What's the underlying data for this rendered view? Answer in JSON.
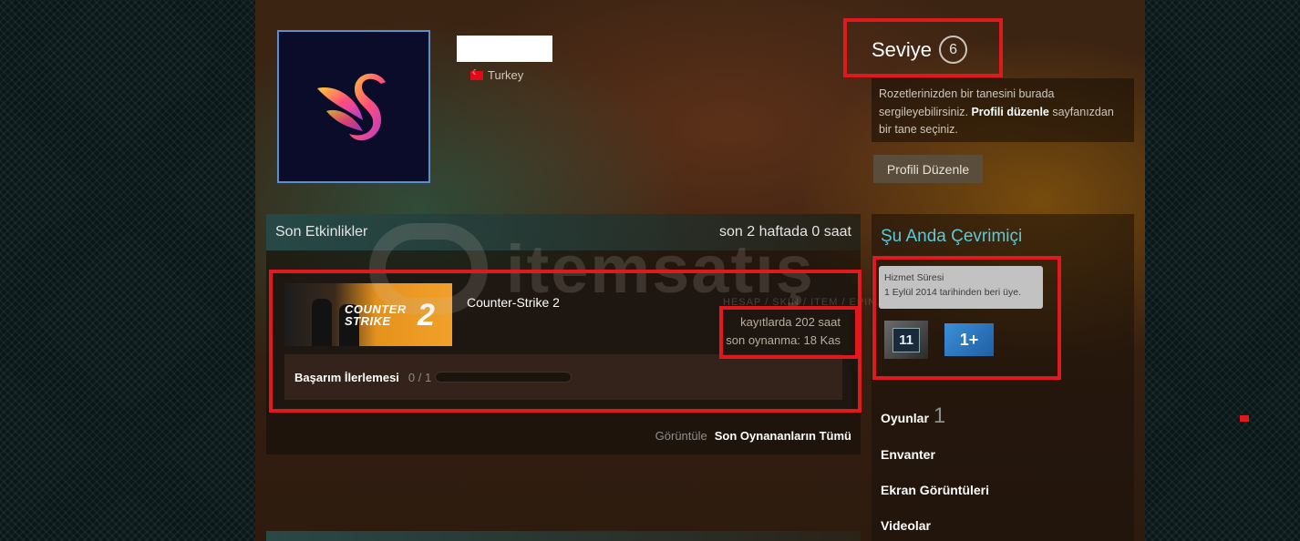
{
  "profile": {
    "country": "Turkey",
    "level_label": "Seviye",
    "level_value": "6",
    "badge_note_1": "Rozetlerinizden bir tanesini burada sergileyebilirsiniz.",
    "badge_note_link": "Profili düzenle",
    "badge_note_2": "sayfanızdan bir tane seçiniz.",
    "edit_button": "Profili Düzenle"
  },
  "activity": {
    "title": "Son Etkinlikler",
    "summary": "son 2 haftada 0 saat",
    "game": {
      "name": "Counter-Strike 2",
      "hours_total": "kayıtlarda 202 saat",
      "last_played": "son oynanma: 18 Kas",
      "logo_line1": "COUNTER",
      "logo_line2": "STRIKE",
      "logo_num": "2"
    },
    "achievement_label": "Başarım İlerlemesi",
    "achievement_count": "0 / 1",
    "achievement_progress": 0,
    "view_label": "Görüntüle",
    "view_link": "Son Oynananların Tümü"
  },
  "sidebar": {
    "online_title": "Şu Anda Çevrimiçi",
    "tooltip_title": "Hizmet Süresi",
    "tooltip_text": "1 Eylül 2014 tarihinden beri üye.",
    "years_badge": "11",
    "plus_badge": "1+",
    "nav": [
      {
        "label": "Oyunlar",
        "count": "1"
      },
      {
        "label": "Envanter"
      },
      {
        "label": "Ekran Görüntüleri"
      },
      {
        "label": "Videolar"
      }
    ]
  },
  "watermark": {
    "text": "itemsatış",
    "sub": "HESAP / SKIN / ITEM / EPIN.COM"
  },
  "colors": {
    "accent_red": "#e0191f",
    "online_blue": "#57cbde"
  }
}
